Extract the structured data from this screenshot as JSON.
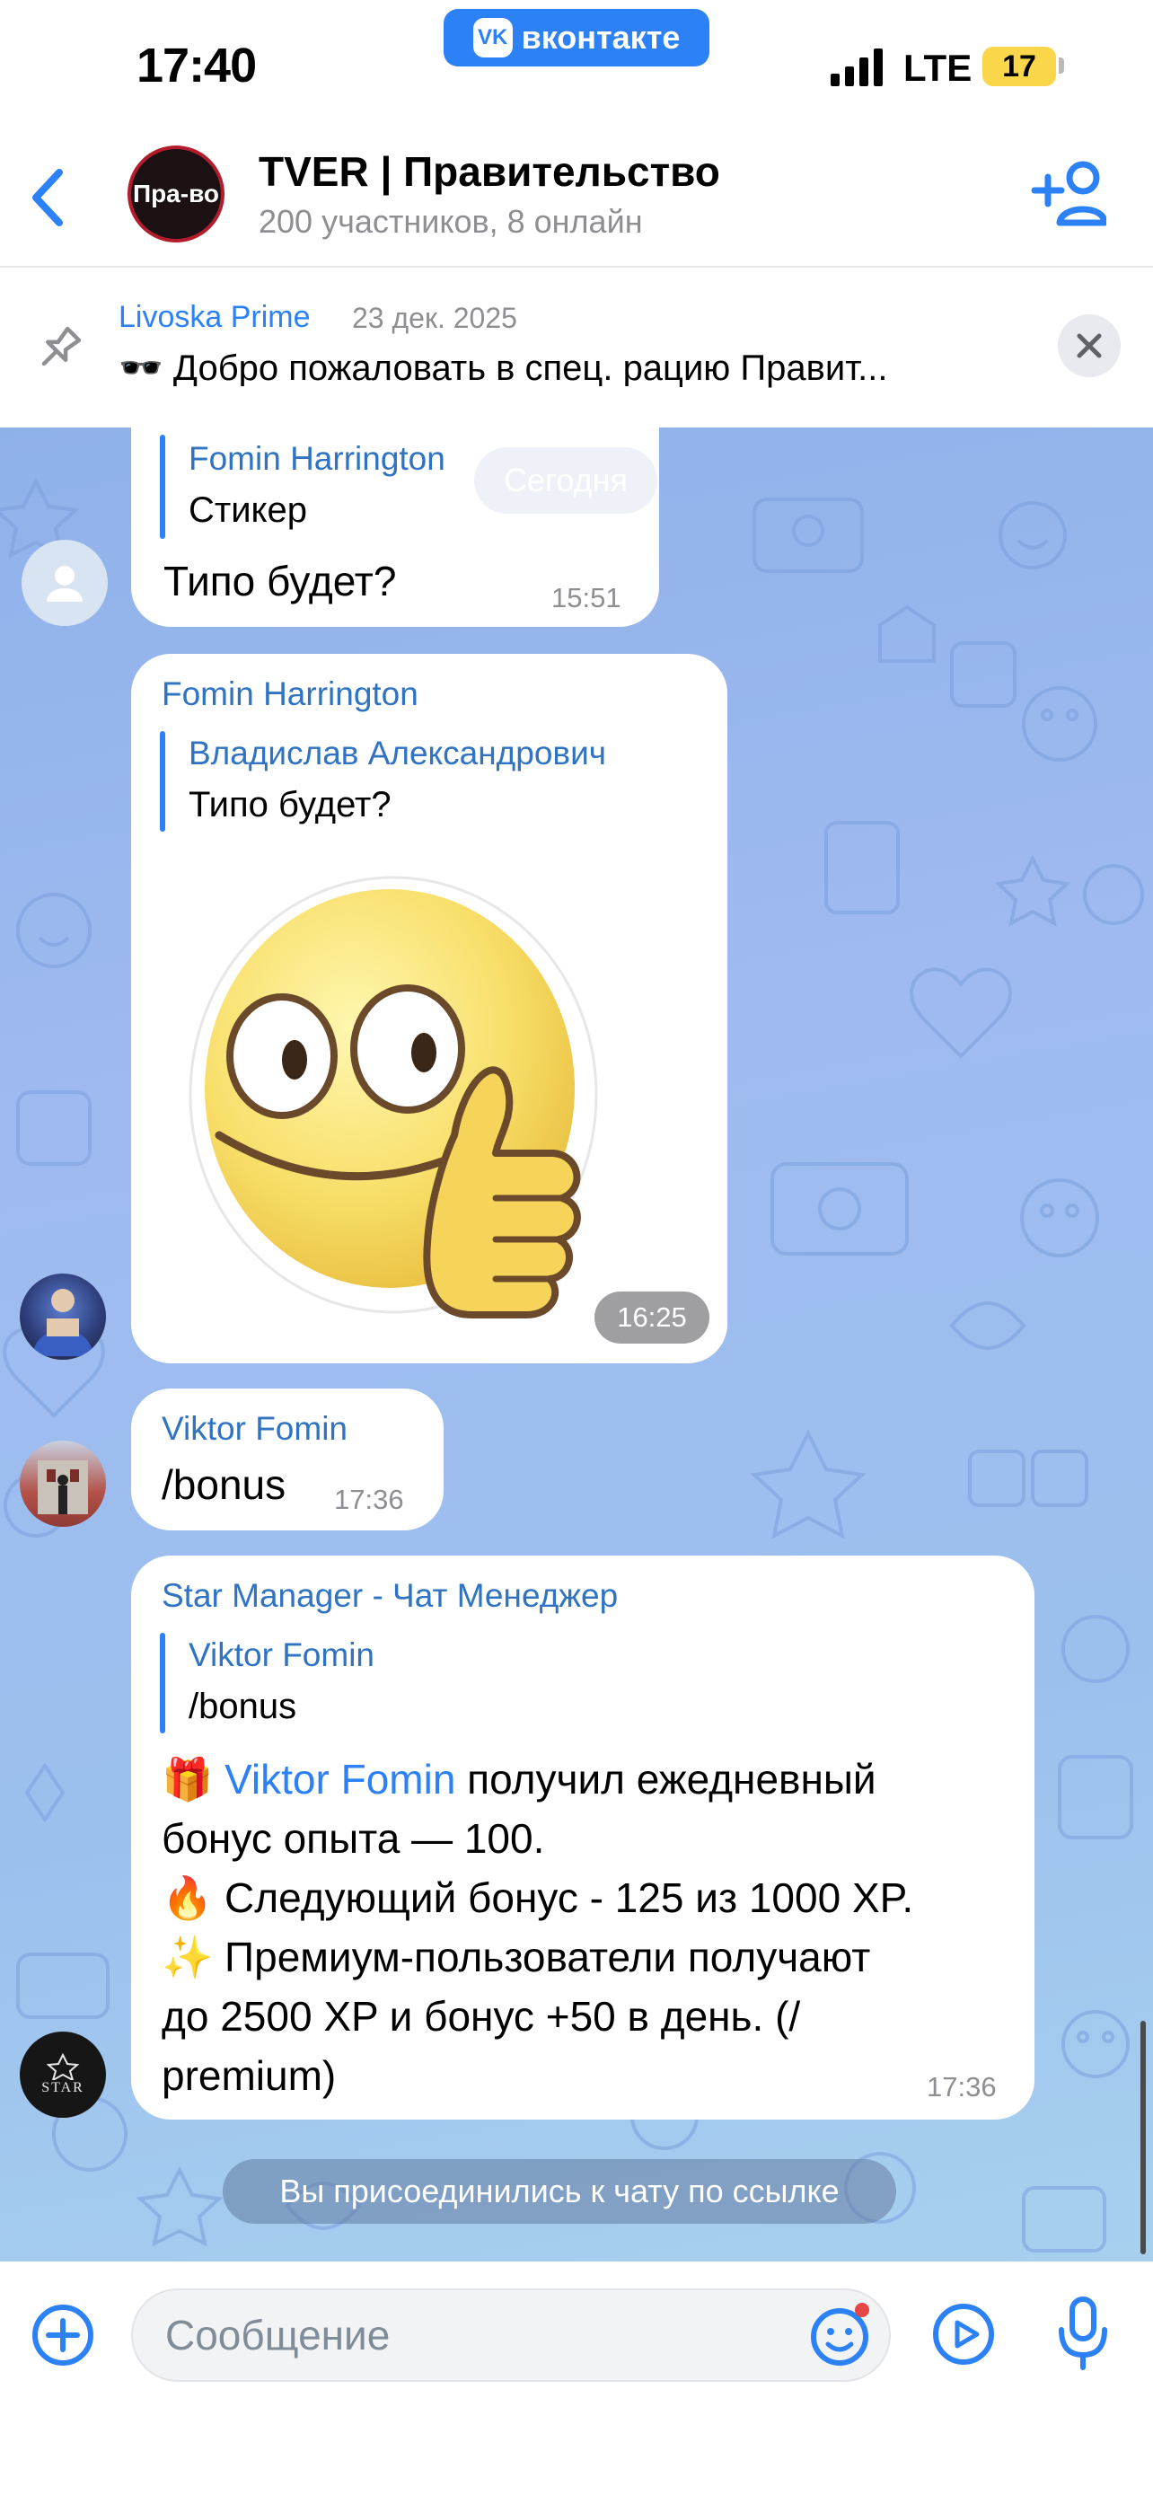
{
  "status_bar": {
    "time": "17:40",
    "app_badge": "вконтакте",
    "network": "LTE",
    "battery": "17"
  },
  "header": {
    "avatar_text": "Пра-во",
    "title": "TVER | Правительство",
    "subtitle": "200 участников, 8 онлайн"
  },
  "pinned": {
    "author": "Livoska Prime",
    "date": "23 дек. 2025",
    "text": "🕶️ Добро пожаловать в спец. рацию Правит..."
  },
  "chat": {
    "date_pill": "Сегодня",
    "messages": [
      {
        "reply_name": "Fomin Harrington",
        "reply_text": "Стикер",
        "text": "Типо будет?",
        "time": "15:51"
      },
      {
        "author": "Fomin Harrington",
        "reply_name": "Владислав Александрович",
        "reply_text": "Типо будет?",
        "sticker": "thumbs-up-smiley-sticker",
        "time": "16:25"
      },
      {
        "author": "Viktor Fomin",
        "text": "/bonus",
        "time": "17:36"
      },
      {
        "author": "Star Manager - Чат Менеджер",
        "reply_name": "Viktor Fomin",
        "reply_text": "/bonus",
        "line1_emoji": "🎁",
        "line1_link": "Viktor Fomin",
        "line1_rest": " получил ежедневный",
        "line2": "бонус опыта — 100.",
        "line3": "🔥 Следующий бонус - 125 из 1000 XP.",
        "line4": "✨ Премиум-пользователи получают",
        "line5": "до 2500 XP и бонус +50 в день. (/",
        "line6": "premium)",
        "time": "17:36",
        "avatar_text": "STAR"
      }
    ],
    "system_message": "Вы присоединились к чату по ссылке"
  },
  "input": {
    "placeholder": "Сообщение"
  },
  "colors": {
    "accent": "#2d81f7",
    "author": "#2f73c2",
    "chat_bg": "#9cbcee"
  }
}
